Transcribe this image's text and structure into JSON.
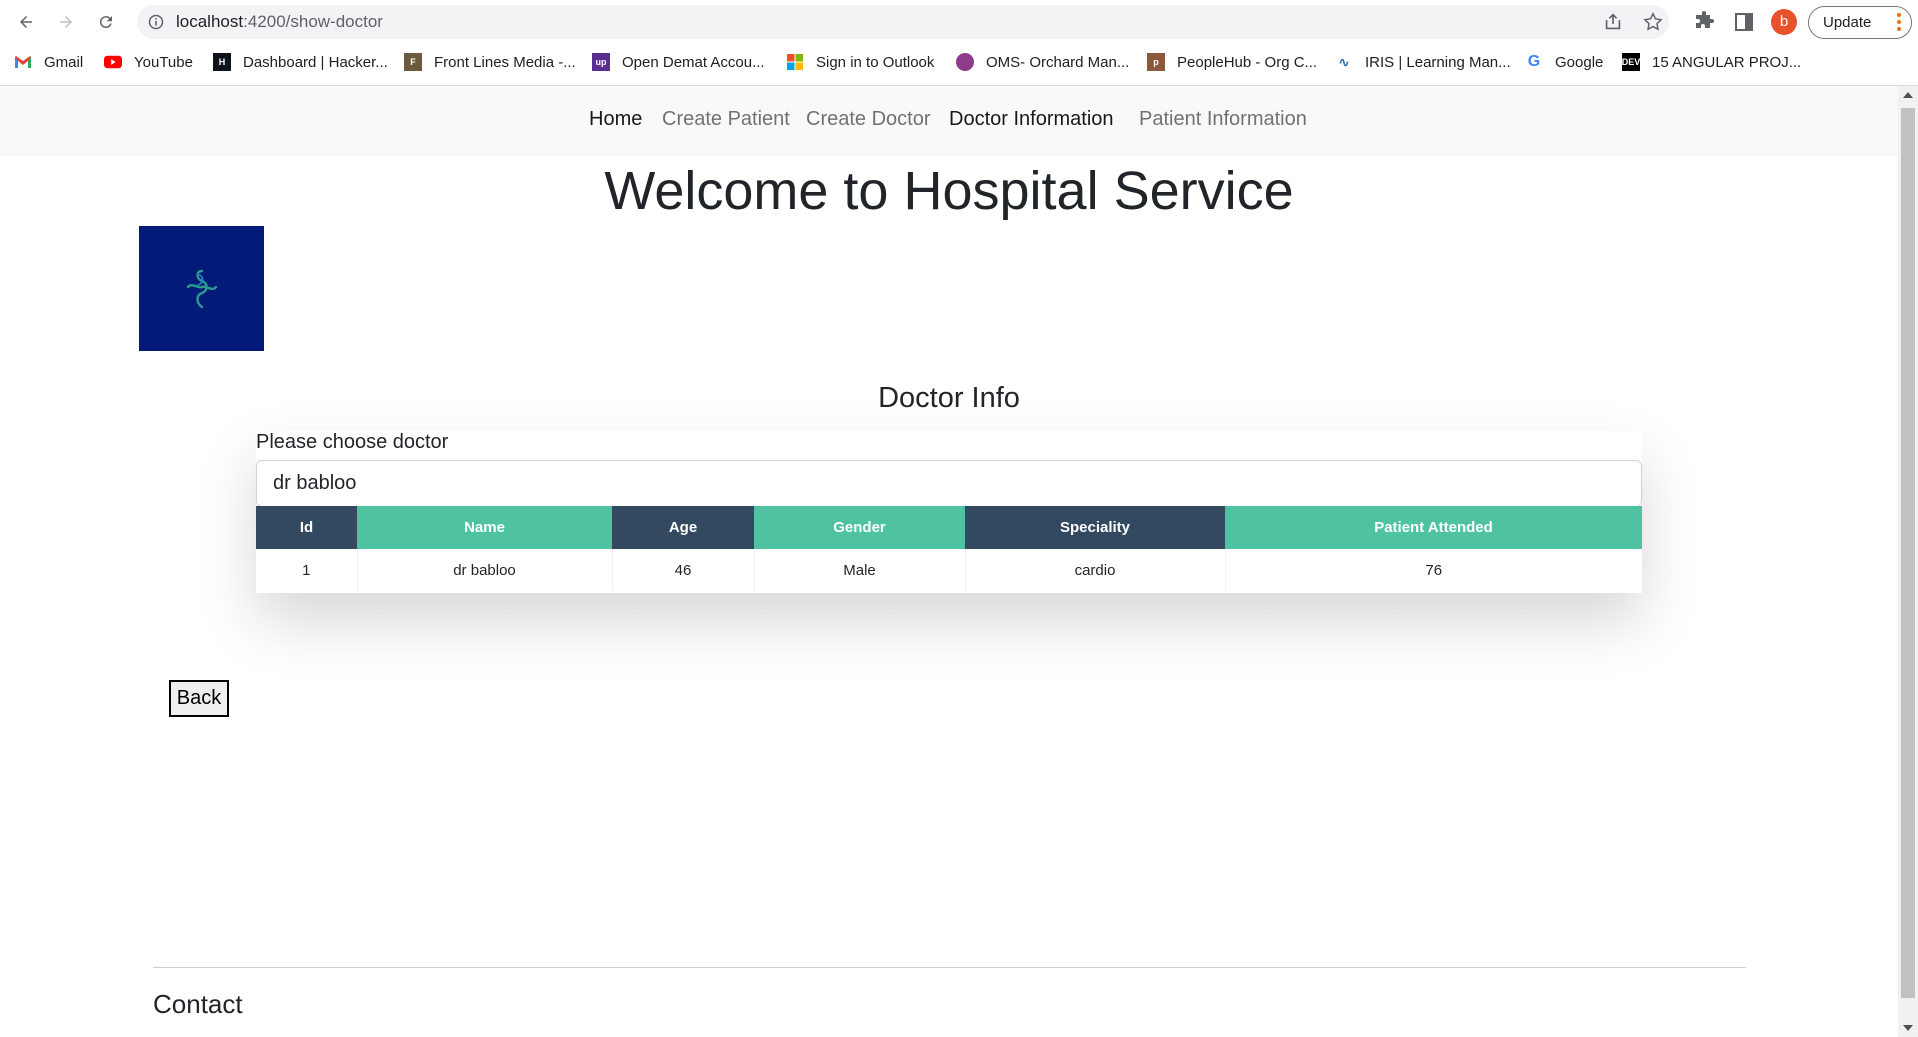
{
  "browser": {
    "url_host": "localhost",
    "url_path": ":4200/show-doctor",
    "profile_initial": "b",
    "update_label": "Update",
    "bookmarks": [
      {
        "label": "Gmail",
        "icon": "gmail-icon",
        "color": "#ea4335"
      },
      {
        "label": "YouTube",
        "icon": "youtube-icon",
        "color": "#ff0000"
      },
      {
        "label": "Dashboard | Hacker...",
        "icon": "hackerrank-icon",
        "color": "#0e141e"
      },
      {
        "label": "Front Lines Media -...",
        "icon": "frontlines-icon",
        "color": "#6b5b3e"
      },
      {
        "label": "Open Demat Accou...",
        "icon": "upstox-icon",
        "color": "#5a2d91"
      },
      {
        "label": "Sign in to Outlook",
        "icon": "microsoft-icon",
        "color": "#f25022"
      },
      {
        "label": "OMS- Orchard Man...",
        "icon": "oms-icon",
        "color": "#8e3b8c"
      },
      {
        "label": "PeopleHub - Org C...",
        "icon": "peoplehub-icon",
        "color": "#8b5a3c"
      },
      {
        "label": "IRIS | Learning Man...",
        "icon": "iris-icon",
        "color": "#2b6cb0"
      },
      {
        "label": "Google",
        "icon": "google-icon",
        "color": "#4285f4"
      },
      {
        "label": "15 ANGULAR PROJ...",
        "icon": "dev-icon",
        "color": "#000000"
      }
    ]
  },
  "navbar": {
    "links": [
      {
        "label": "Home",
        "active": true
      },
      {
        "label": "Create Patient",
        "active": false
      },
      {
        "label": "Create Doctor",
        "active": false
      },
      {
        "label": "Doctor Information",
        "active": true
      },
      {
        "label": "Patient Information",
        "active": false
      }
    ]
  },
  "page": {
    "title": "Welcome to Hospital Service",
    "logo_icon": "medical-cross-icon",
    "logo_bg": "#021b79",
    "section_title": "Doctor Info",
    "choose_label": "Please choose doctor",
    "selected_doctor": "dr babloo",
    "back_label": "Back",
    "footer_heading": "Contact"
  },
  "table": {
    "headers": [
      "Id",
      "Name",
      "Age",
      "Gender",
      "Speciality",
      "Patient Attended"
    ],
    "rows": [
      [
        "1",
        "dr babloo",
        "46",
        "Male",
        "cardio",
        "76"
      ]
    ],
    "header_colors": {
      "dark": "#324960",
      "teal": "#4fc3a1"
    }
  }
}
